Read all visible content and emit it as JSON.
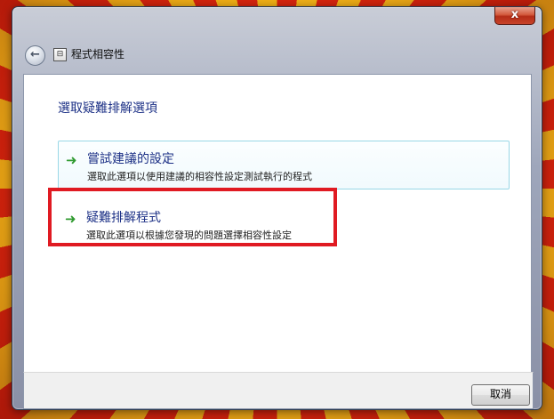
{
  "window": {
    "title": "程式相容性",
    "close_label": "x",
    "app_icon_glyph": "⊟"
  },
  "main": {
    "heading": "選取疑難排解選項",
    "options": [
      {
        "icon": "green-arrow",
        "title": "嘗試建議的設定",
        "description": "選取此選項以使用建議的相容性設定測試執行的程式"
      },
      {
        "icon": "green-arrow",
        "title": "疑難排解程式",
        "description": "選取此選項以根據您發現的問題選擇相容性設定"
      }
    ]
  },
  "footer": {
    "cancel_label": "取消"
  },
  "colors": {
    "heading": "#1e3287",
    "highlight_box": "#e01a22",
    "arrow": "#2f9a2f"
  }
}
